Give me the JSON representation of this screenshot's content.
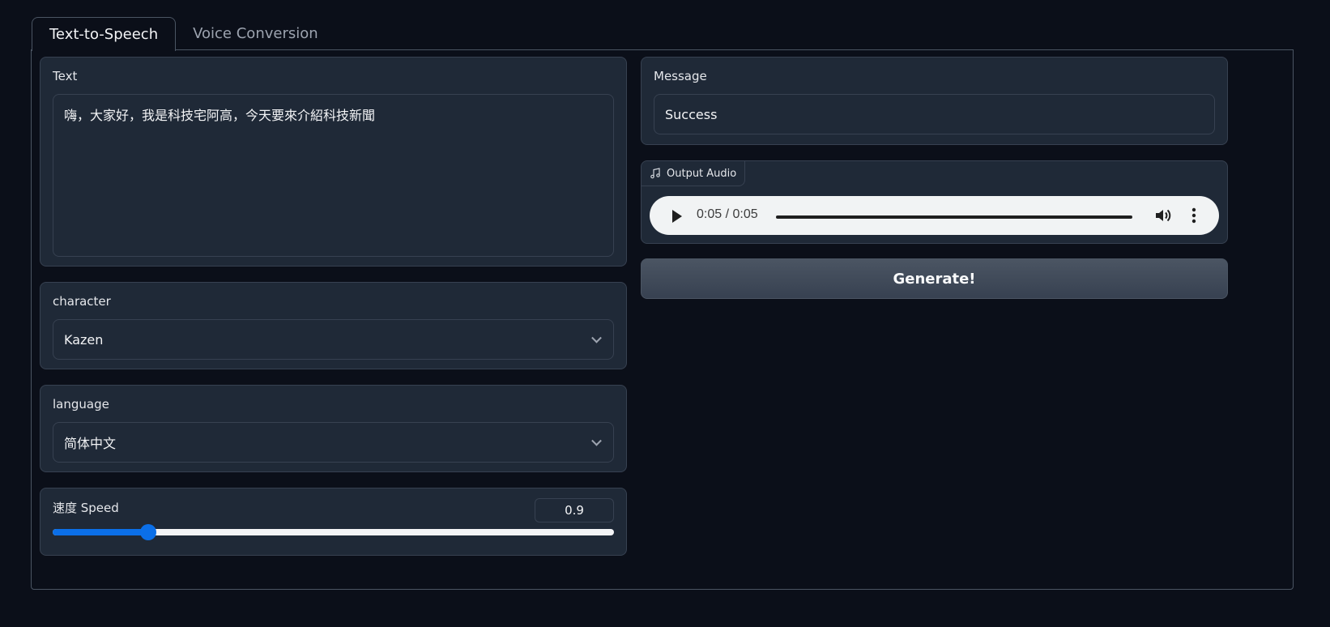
{
  "tabs": [
    {
      "label": "Text-to-Speech",
      "active": true
    },
    {
      "label": "Voice Conversion",
      "active": false
    }
  ],
  "text_box": {
    "label": "Text",
    "value": "嗨，大家好，我是科技宅阿高，今天要來介紹科技新聞"
  },
  "character": {
    "label": "character",
    "value": "Kazen"
  },
  "language": {
    "label": "language",
    "value": "简体中文"
  },
  "speed": {
    "label": "速度 Speed",
    "value": "0.9",
    "fraction": 0.17
  },
  "message": {
    "label": "Message",
    "value": "Success"
  },
  "output_audio": {
    "label": "Output Audio",
    "icon": "music-note-icon",
    "time": "0:05 / 0:05"
  },
  "generate_button": {
    "label": "Generate!"
  },
  "colors": {
    "background": "#0b0f19",
    "card": "#1f2937",
    "border": "#374151",
    "accent": "#0b6fe8"
  }
}
